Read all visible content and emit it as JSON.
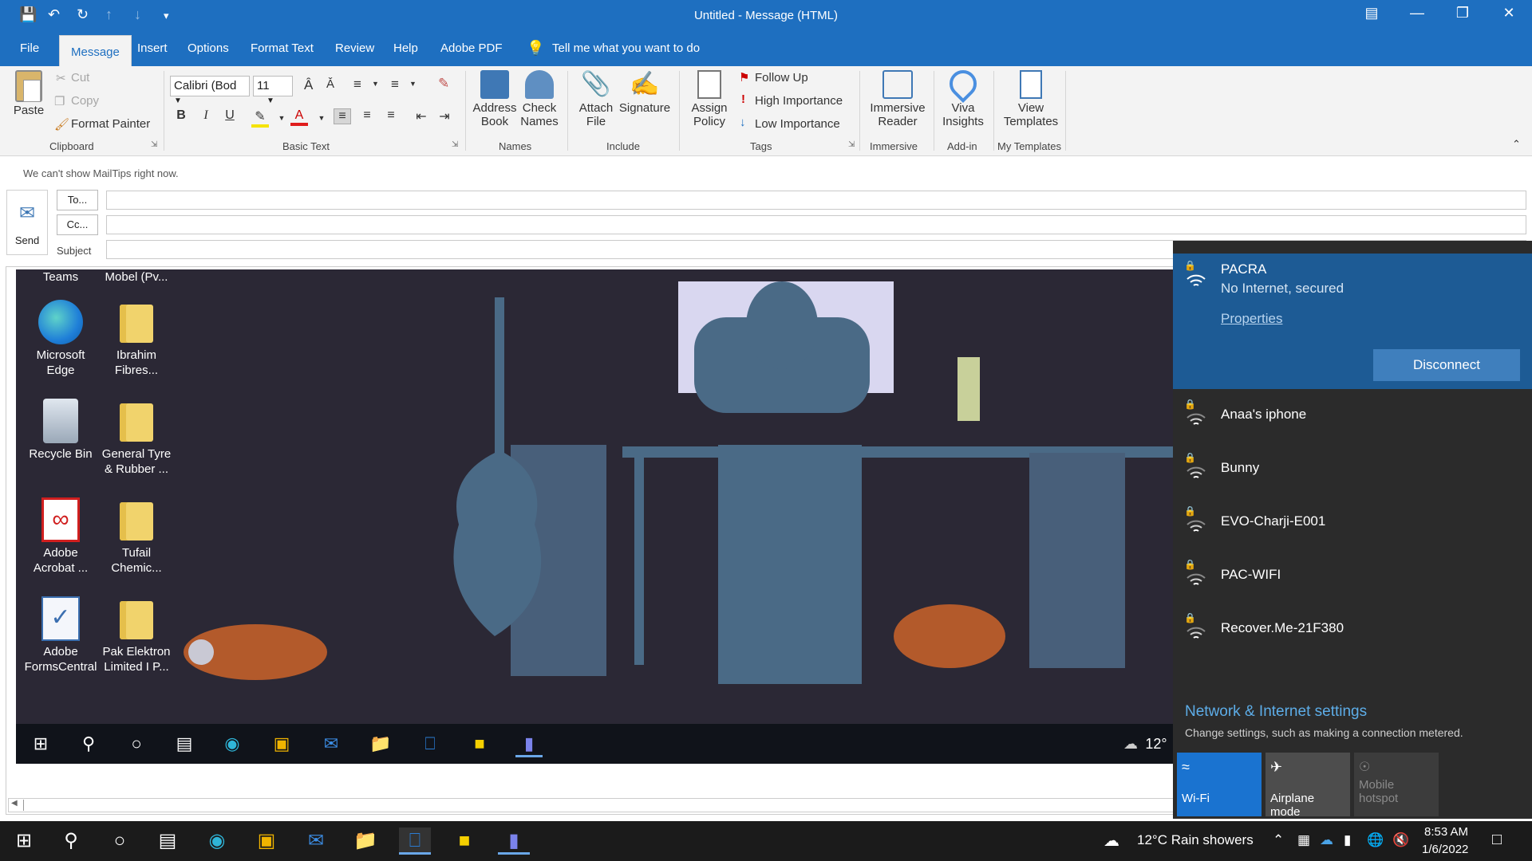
{
  "window": {
    "title": "Untitled  -  Message (HTML)"
  },
  "menu": {
    "tabs": [
      "File",
      "Message",
      "Insert",
      "Options",
      "Format Text",
      "Review",
      "Help",
      "Adobe PDF"
    ],
    "tell_me": "Tell me what you want to do"
  },
  "ribbon": {
    "clipboard": {
      "paste": "Paste",
      "cut": "Cut",
      "copy": "Copy",
      "format_painter": "Format Painter",
      "group": "Clipboard"
    },
    "basic_text": {
      "font": "Calibri (Bod",
      "size": "11",
      "group": "Basic Text"
    },
    "names": {
      "address_book_1": "Address",
      "address_book_2": "Book",
      "check_names_1": "Check",
      "check_names_2": "Names",
      "group": "Names"
    },
    "include": {
      "attach_1": "Attach",
      "attach_2": "File",
      "signature": "Signature",
      "group": "Include"
    },
    "tags": {
      "assign_1": "Assign",
      "assign_2": "Policy",
      "follow_up": "Follow Up",
      "high": "High Importance",
      "low": "Low Importance",
      "group": "Tags"
    },
    "immersive": {
      "label_1": "Immersive",
      "label_2": "Reader",
      "group": "Immersive"
    },
    "addin": {
      "label_1": "Viva",
      "label_2": "Insights",
      "group": "Add-in"
    },
    "templates": {
      "label_1": "View",
      "label_2": "Templates",
      "group": "My Templates"
    }
  },
  "compose": {
    "mailtips": "We can't show MailTips right now.",
    "send": "Send",
    "to": "To...",
    "cc": "Cc...",
    "subject": "Subject"
  },
  "desktop_icons": [
    {
      "label_1": "Teams",
      "label_2": ""
    },
    {
      "label_1": "Mobel (Pv...",
      "label_2": ""
    },
    {
      "label_1": "Microsoft",
      "label_2": "Edge"
    },
    {
      "label_1": "Ibrahim",
      "label_2": "Fibres..."
    },
    {
      "label_1": "Recycle Bin",
      "label_2": ""
    },
    {
      "label_1": "General Tyre",
      "label_2": "& Rubber ..."
    },
    {
      "label_1": "Adobe",
      "label_2": "Acrobat ..."
    },
    {
      "label_1": "Tufail",
      "label_2": "Chemic..."
    },
    {
      "label_1": "Adobe",
      "label_2": "FormsCentral"
    },
    {
      "label_1": "Pak Elektron",
      "label_2": "Limited I P..."
    }
  ],
  "inner_taskbar": {
    "temp": "12°"
  },
  "network": {
    "connected": {
      "name": "PACRA",
      "status": "No Internet, secured",
      "properties": "Properties",
      "disconnect": "Disconnect"
    },
    "others": [
      "Anaa's iphone",
      "Bunny",
      "EVO-Charji-E001",
      "PAC-WIFI",
      "Recover.Me-21F380"
    ],
    "settings_title": "Network & Internet settings",
    "settings_desc": "Change settings, such as making a connection metered.",
    "tiles": [
      {
        "label": "Wi-Fi",
        "state": "on"
      },
      {
        "label": "Airplane mode",
        "state": "off"
      },
      {
        "label_1": "Mobile",
        "label_2": "hotspot",
        "state": "disabled"
      }
    ]
  },
  "taskbar": {
    "weather": "12°C  Rain showers",
    "time": "8:53 AM",
    "date": "1/6/2022"
  },
  "colors": {
    "accent": "#1e6fc0",
    "wifi_selected": "#1d5b95",
    "wifi_tile": "#1a73d0"
  }
}
